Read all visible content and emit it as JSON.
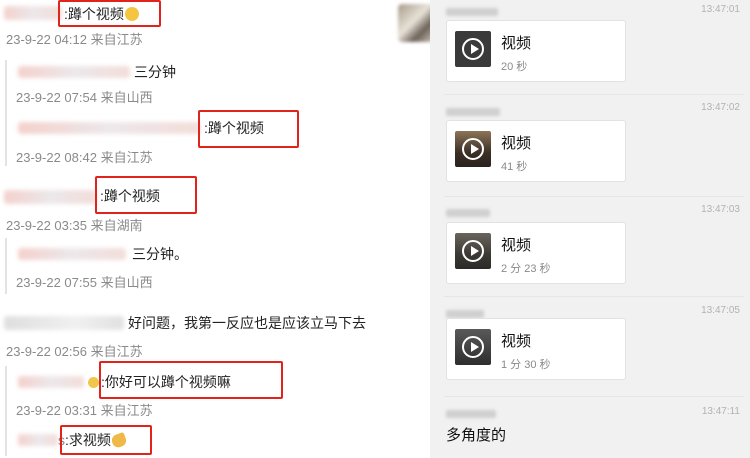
{
  "left_comments": {
    "c1": {
      "text": ":蹲个视频",
      "meta": "23-9-22 04:12 来自江苏",
      "emoji": "crying-laughing-emoji"
    },
    "r1a": {
      "text": "三分钟",
      "meta": "23-9-22 07:54 来自山西"
    },
    "r1b": {
      "text": ":蹲个视频",
      "meta": "23-9-22 08:42 来自江苏"
    },
    "c2": {
      "text": ":蹲个视频",
      "meta": "23-9-22 03:35 来自湖南"
    },
    "r2a": {
      "text": "三分钟。",
      "meta": "23-9-22 07:55 来自山西"
    },
    "c3": {
      "text": "好问题，我第一反应也是应该立马下去",
      "meta": "23-9-22 02:56 来自江苏"
    },
    "r3a": {
      "text": ":你好可以蹲个视频嘛",
      "meta": "23-9-22 03:31 来自江苏"
    },
    "r3b": {
      "prefix": "s",
      "text": ":求视频",
      "emoji": "clap-emoji"
    }
  },
  "right_chat": {
    "messages": [
      {
        "time": "13:47:01",
        "label": "视频",
        "duration": "20 秒"
      },
      {
        "time": "13:47:02",
        "label": "视频",
        "duration": "41 秒"
      },
      {
        "time": "13:47:03",
        "label": "视频",
        "duration": "2 分 23 秒"
      },
      {
        "time": "13:47:05",
        "label": "视频",
        "duration": "1 分 30 秒"
      }
    ],
    "last": {
      "time": "13:47:11",
      "text": "多角度的"
    }
  },
  "colors": {
    "highlight": "#e0241c",
    "meta_grey": "#8a8a8a",
    "chat_bg": "#f1f1f1"
  }
}
